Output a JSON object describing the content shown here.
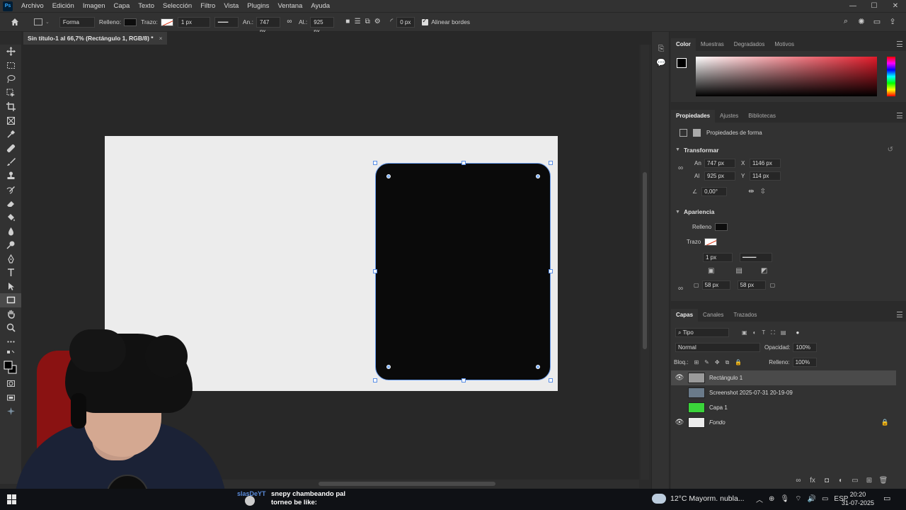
{
  "menubar": {
    "logo": "Ps",
    "items": [
      "Archivo",
      "Edición",
      "Imagen",
      "Capa",
      "Texto",
      "Selección",
      "Filtro",
      "Vista",
      "Plugins",
      "Ventana",
      "Ayuda"
    ]
  },
  "options": {
    "mode": "Forma",
    "fill_label": "Relleno:",
    "stroke_label": "Trazo:",
    "stroke_width": "1 px",
    "width_label": "An.:",
    "width_value": "747 px",
    "height_label": "Al.:",
    "height_value": "925 px",
    "radius_value": "0 px",
    "align_edges": "Alinear bordes"
  },
  "document": {
    "tab_title": "Sin título-1 al 66,7% (Rectángulo 1, RGB/8) *",
    "close": "×"
  },
  "color_panel": {
    "tabs": [
      "Color",
      "Muestras",
      "Degradados",
      "Motivos"
    ],
    "active": "Color",
    "foreground": "#000000",
    "spectrum_hue": "#e21b2a"
  },
  "properties_panel": {
    "tabs": [
      "Propiedades",
      "Ajustes",
      "Bibliotecas"
    ],
    "subtitle": "Propiedades de forma",
    "transform_title": "Transformar",
    "w_label": "An",
    "w_value": "747 px",
    "x_label": "X",
    "x_value": "1146 px",
    "h_label": "Al",
    "h_value": "925 px",
    "y_label": "Y",
    "y_value": "114 px",
    "angle": "0,00°",
    "appearance_title": "Apariencia",
    "fill_label": "Relleno",
    "stroke_label": "Trazo",
    "stroke_width": "1 px",
    "corner_1": "58 px",
    "corner_2": "58 px"
  },
  "layers_panel": {
    "tabs": [
      "Capas",
      "Canales",
      "Trazados"
    ],
    "filter": "Tipo",
    "blend_mode": "Normal",
    "opacity_label": "Opacidad:",
    "opacity_value": "100%",
    "lock_label": "Bloq.:",
    "fill_label": "Relleno:",
    "fill_value": "100%",
    "layers": [
      {
        "name": "Rectángulo 1",
        "visible": true,
        "selected": true,
        "thumb": "#9a9a9a"
      },
      {
        "name": "Screenshot 2025-07-31 20-19-09",
        "visible": false,
        "selected": false,
        "thumb": "#6a7a8a"
      },
      {
        "name": "Capa 1",
        "visible": false,
        "selected": false,
        "thumb": "#3ad43a"
      },
      {
        "name": "Fondo",
        "visible": true,
        "selected": false,
        "thumb": "#ececec",
        "locked": true
      }
    ]
  },
  "taskbar": {
    "chat_user": "slasDeYT",
    "chat_line1": "snepy chambeando pal",
    "chat_line2": "torneo be like:",
    "weather": "12°C  Mayorm. nubla...",
    "language": "ESP",
    "time": "20:20",
    "date": "31-07-2025"
  }
}
